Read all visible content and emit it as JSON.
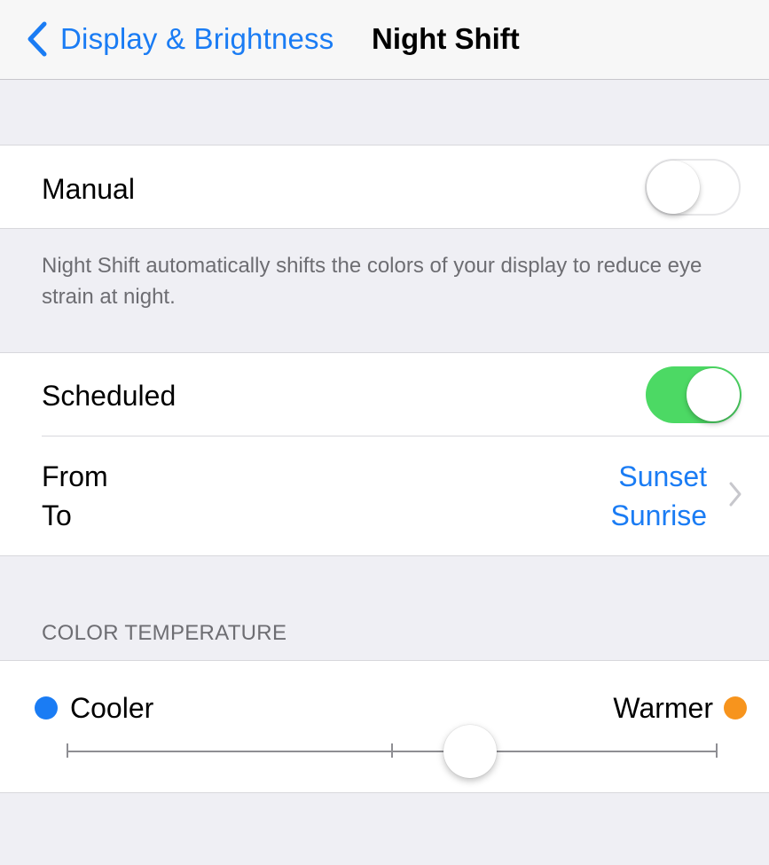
{
  "nav": {
    "back_label": "Display & Brightness",
    "title": "Night Shift"
  },
  "manual": {
    "label": "Manual",
    "enabled": false
  },
  "footer": {
    "description": "Night Shift automatically shifts the colors of your display to reduce eye strain at night."
  },
  "scheduled": {
    "label": "Scheduled",
    "enabled": true
  },
  "schedule": {
    "from_label": "From",
    "to_label": "To",
    "from_value": "Sunset",
    "to_value": "Sunrise"
  },
  "color_temperature": {
    "header": "COLOR TEMPERATURE",
    "cooler_label": "Cooler",
    "warmer_label": "Warmer",
    "level": 0.62
  },
  "colors": {
    "accent": "#1a7cf4",
    "switch_on": "#4cd964",
    "cooler_dot": "#1a7cf4",
    "warmer_dot": "#f7941d",
    "background": "#efeff4"
  },
  "icons": {
    "back": "chevron-left-icon",
    "disclosure": "chevron-right-icon"
  }
}
